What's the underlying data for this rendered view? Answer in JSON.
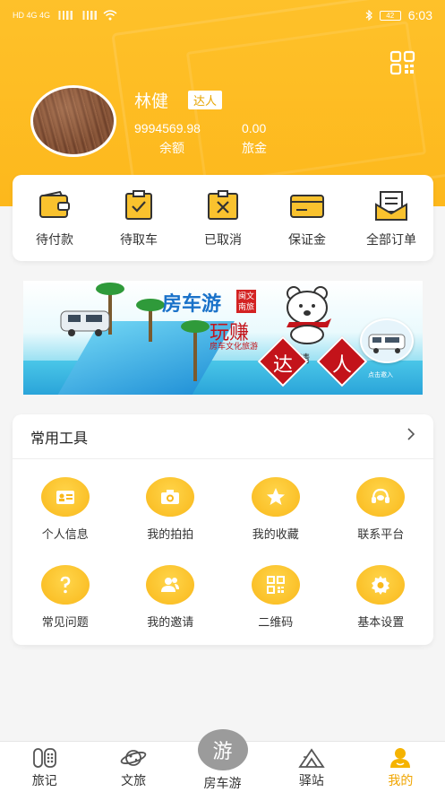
{
  "status_bar": {
    "left_text": "HD 4G 4G",
    "battery": "42",
    "time": "6:03"
  },
  "user": {
    "name": "林健",
    "badge": "达人"
  },
  "balance": {
    "value": "9994569.98",
    "label": "余额"
  },
  "travel_fund": {
    "value": "0.00",
    "label": "旅金"
  },
  "orders": [
    {
      "label": "待付款",
      "icon": "wallet-icon"
    },
    {
      "label": "待取车",
      "icon": "clipboard-check-icon"
    },
    {
      "label": "已取消",
      "icon": "cancel-box-icon"
    },
    {
      "label": "保证金",
      "icon": "card-icon"
    },
    {
      "label": "全部订单",
      "icon": "orders-envelope-icon"
    }
  ],
  "banner": {
    "title": "房车游",
    "seal": "闽文南旅",
    "play_text": "玩赚",
    "sub_text": "房车文化旅游",
    "invite_text": "邀请",
    "daren_left": "达",
    "daren_right": "人",
    "click_text": "点击邀入"
  },
  "tools": {
    "title": "常用工具",
    "items": [
      {
        "label": "个人信息",
        "icon": "id-card-icon"
      },
      {
        "label": "我的拍拍",
        "icon": "camera-icon"
      },
      {
        "label": "我的收藏",
        "icon": "star-icon"
      },
      {
        "label": "联系平台",
        "icon": "headset-icon"
      },
      {
        "label": "常见问题",
        "icon": "question-icon"
      },
      {
        "label": "我的邀请",
        "icon": "users-icon"
      },
      {
        "label": "二维码",
        "icon": "qr-code-icon"
      },
      {
        "label": "基本设置",
        "icon": "gear-icon"
      }
    ]
  },
  "tabbar": {
    "items": [
      {
        "label": "旅记"
      },
      {
        "label": "文旅"
      },
      {
        "label": "房车游",
        "center_glyph": "游"
      },
      {
        "label": "驿站"
      },
      {
        "label": "我的"
      }
    ],
    "active": "我的"
  },
  "colors": {
    "accent": "#fdb81c",
    "active_tab": "#f0a500"
  }
}
